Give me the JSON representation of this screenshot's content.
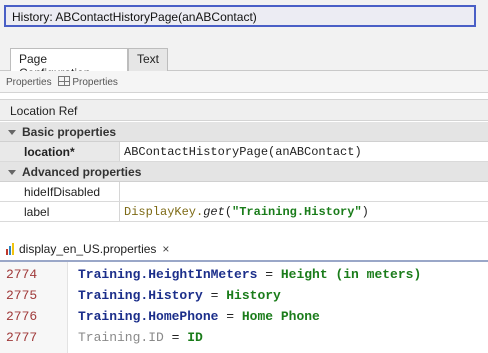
{
  "window": {
    "title": "History: ABContactHistoryPage(anABContact)"
  },
  "tabs": [
    {
      "label": "Page Configuration",
      "active": true
    },
    {
      "label": "Text",
      "active": false
    }
  ],
  "properties_bar": {
    "label_left": "Properties",
    "label_right": "Properties"
  },
  "location_ref": {
    "header": "Location Ref"
  },
  "property_sections": {
    "basic": {
      "title": "Basic properties",
      "rows": [
        {
          "key": "location*",
          "value": "ABContactHistoryPage(anABContact)"
        }
      ]
    },
    "advanced": {
      "title": "Advanced properties",
      "rows": [
        {
          "key": "hideIfDisabled",
          "value": ""
        },
        {
          "key": "label",
          "value_prefix": "DisplayKey.",
          "value_method": "get",
          "value_args_open": "(",
          "value_string": "\"Training.History\"",
          "value_args_close": ")"
        }
      ]
    }
  },
  "file_tab": {
    "name": "display_en_US.properties",
    "close_glyph": "×"
  },
  "code_lines": [
    {
      "line": "2774",
      "key": "Training.HeightInMeters",
      "eq": " = ",
      "value": "Height (in meters)",
      "dim": false
    },
    {
      "line": "2775",
      "key": "Training.History",
      "eq": " = ",
      "value": "History",
      "dim": false
    },
    {
      "line": "2776",
      "key": "Training.HomePhone",
      "eq": " = ",
      "value": "Home Phone",
      "dim": false
    },
    {
      "line": "2777",
      "key": "Training.ID",
      "eq": " = ",
      "value": "ID",
      "dim": true
    }
  ],
  "colors": {
    "title_border": "#4a5fc6",
    "code_key": "#1b2e8a",
    "code_value": "#1a7c1a",
    "line_number": "#a03a3a"
  }
}
